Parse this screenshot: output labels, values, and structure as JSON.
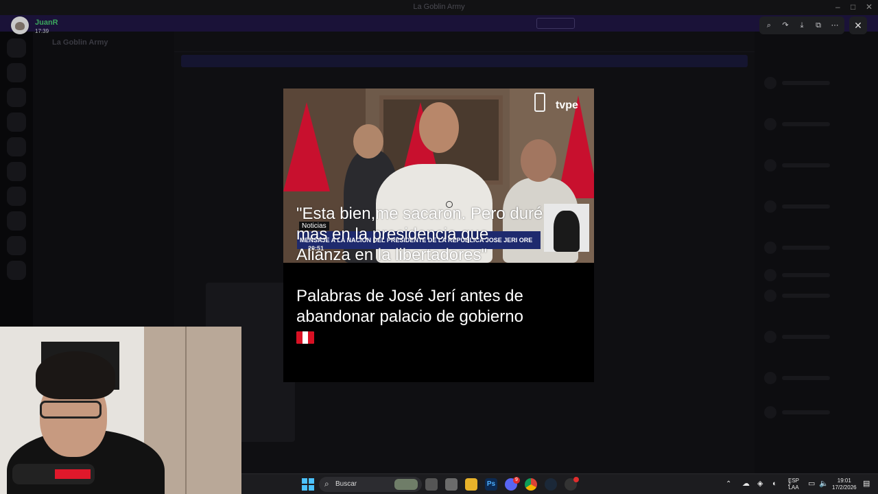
{
  "window": {
    "title": "La Goblin Army"
  },
  "uploader": {
    "name": "JuanR",
    "time": "17:39"
  },
  "media": {
    "channel_logo": "tvpe",
    "ticker_label": "Noticias",
    "ticker_code": "20:51",
    "ticker_text": "MENSAJE A LA NACION DEL PRESIDENTE DE LA REPUBLICA JOSE JERI ORE",
    "caption_quote": "\"Esta bien,me sacaron. Pero duré\nmas en la presidencia que\nAlianza en la libertadores\"",
    "caption_source": "Palabras de José Jerí antes de\nabandonar palacio de gobierno",
    "caption_flag": "🇵🇪"
  },
  "viewer_tools": {
    "icons": [
      "zoom-in-icon",
      "forward-icon",
      "download-icon",
      "open-external-icon",
      "more-icon",
      "close-icon"
    ]
  },
  "taskbar": {
    "search_placeholder": "Buscar",
    "language": "ESP",
    "layout": "LAA",
    "time": "19:01",
    "date": "17/2/2026",
    "discord_badge": "9"
  },
  "colors": {
    "username": "#3ba55d",
    "peru_red": "#d91023",
    "taskbar_bg": "#1c1c1f",
    "viewer_bg": "#0b0b0d"
  }
}
